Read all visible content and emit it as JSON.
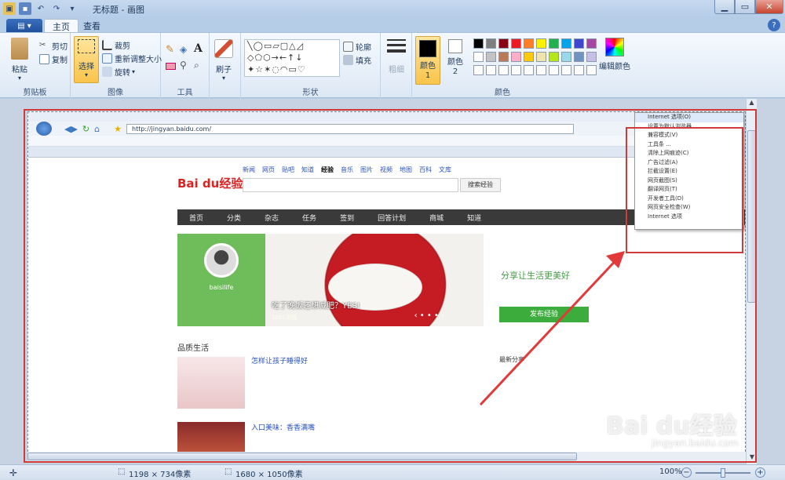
{
  "window": {
    "title": "无标题 - 画图",
    "qat": [
      "save",
      "undo",
      "redo",
      "customize"
    ]
  },
  "menu": {
    "file_label": "▤ ▾",
    "tabs": [
      "主页",
      "查看"
    ]
  },
  "ribbon": {
    "clipboard": {
      "paste": "粘贴",
      "cut": "剪切",
      "copy": "复制",
      "label": "剪贴板"
    },
    "image": {
      "select": "选择",
      "crop": "裁剪",
      "resize": "重新调整大小",
      "rotate": "旋转",
      "label": "图像"
    },
    "tools": {
      "label": "工具"
    },
    "brushes": {
      "label": "刷子"
    },
    "shapes": {
      "outline": "轮廓",
      "fill": "填充",
      "label": "形状"
    },
    "size": {
      "label": "粗细"
    },
    "colors": {
      "color1": "颜色 1",
      "color2": "颜色 2",
      "edit": "编辑颜色",
      "label": "颜色",
      "palette_row1": [
        "#000000",
        "#7f7f7f",
        "#880015",
        "#ed1c24",
        "#ff7f27",
        "#fff200",
        "#22b14c",
        "#00a2e8",
        "#3f48cc",
        "#a349a4"
      ],
      "palette_row2": [
        "#ffffff",
        "#c3c3c3",
        "#b97a57",
        "#ffaec9",
        "#ffc90e",
        "#efe4b0",
        "#b5e61d",
        "#99d9ea",
        "#7092be",
        "#c8bfe7"
      ]
    }
  },
  "browser_shot": {
    "url": "http://jingyan.baidu.com/",
    "logo": "Bai du经验",
    "nav_links": [
      "新闻",
      "网页",
      "贴吧",
      "知道",
      "经验",
      "音乐",
      "图片",
      "视频",
      "地图",
      "百科",
      "文库"
    ],
    "search_button": "搜索经验",
    "site_nav": [
      "首页",
      "分类",
      "杂志",
      "任务",
      "签到",
      "回答计划",
      "商城",
      "知道"
    ],
    "user_name": "baisilife",
    "banner_caption": "吃了晚饭还想减肥？YES!",
    "banner_sub": "1681浏览",
    "share_slogan": "分享让生活更美好",
    "publish_button": "发布经验",
    "quality_life": "品质生活",
    "article1": "怎样让孩子睡得好",
    "article2": "入口美味：香香满嘴",
    "latest": "最新分享",
    "tools_menu": [
      "Internet 选项(O)",
      "设置为默认浏览器",
      "兼容模式(V)",
      "工具条 ...",
      "清除上网痕迹(C)",
      "广告过滤(A)",
      "拦截设置(E)",
      "网页截图(S)",
      "翻译网页(T)",
      "开发者工具(D)",
      "网页安全检查(W)",
      "Internet 选项"
    ]
  },
  "status": {
    "selection_size": "1198 × 734像素",
    "canvas_size": "1680 × 1050像素",
    "zoom": "100%"
  },
  "watermark": {
    "logo": "Bai du经验",
    "url": "jingyan.baidu.com"
  }
}
